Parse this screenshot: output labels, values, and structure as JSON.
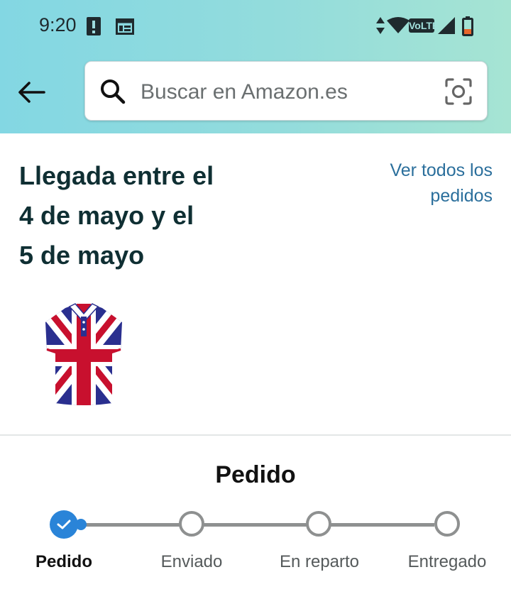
{
  "status_bar": {
    "time": "9:20",
    "network": "VoLTE",
    "icons": [
      "alert-icon",
      "calendar-icon",
      "data-arrows-icon",
      "wifi-icon",
      "signal-icon",
      "battery-low-icon"
    ]
  },
  "header": {
    "search": {
      "placeholder": "Buscar en Amazon.es",
      "value": ""
    },
    "colors": {
      "gradient_start": "#83d7e3",
      "gradient_end": "#a6e4d3"
    }
  },
  "order": {
    "arrival_lines": [
      "Llegada entre el",
      "4 de mayo y el",
      "5 de mayo"
    ],
    "view_all_lines": [
      "Ver todos los",
      "pedidos"
    ],
    "product_image": "union-jack-polo-shirt",
    "status_title": "Pedido",
    "progress": {
      "steps": [
        {
          "label": "Pedido",
          "completed": true,
          "current": true
        },
        {
          "label": "Enviado",
          "completed": false,
          "current": false
        },
        {
          "label": "En reparto",
          "completed": false,
          "current": false
        },
        {
          "label": "Entregado",
          "completed": false,
          "current": false
        }
      ],
      "completed_fraction": 0.0,
      "accent_color": "#2a84d8"
    }
  }
}
